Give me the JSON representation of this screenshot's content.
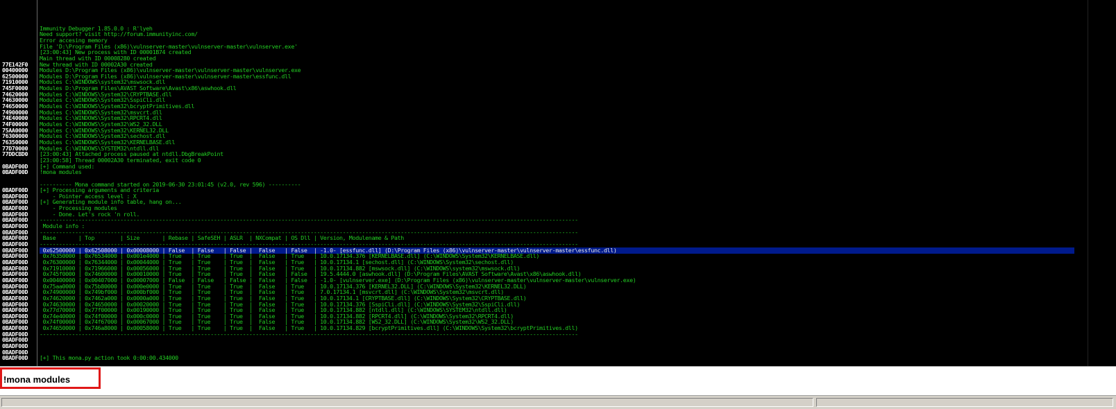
{
  "log": {
    "lines": [
      {
        "addr": "",
        "text": ""
      },
      {
        "addr": "",
        "text": ""
      },
      {
        "addr": "",
        "text": ""
      },
      {
        "addr": "",
        "text": ""
      },
      {
        "addr": "",
        "text": "Immunity Debugger 1.85.0.0 : R'lyeh"
      },
      {
        "addr": "",
        "text": "Need support? visit http://forum.immunityinc.com/"
      },
      {
        "addr": "",
        "text": "Error accesing memory"
      },
      {
        "addr": "",
        "text": "File 'D:\\Program Files (x86)\\vulnserver-master\\vulnserver-master\\vulnserver.exe'"
      },
      {
        "addr": "",
        "text": "[23:00:43] New process with ID 00001B74 created"
      },
      {
        "addr": "",
        "text": "Main thread with ID 00008280 created"
      },
      {
        "addr": "77E142F0",
        "text": "New thread with ID 00002A30 created"
      },
      {
        "addr": "00400000",
        "text": "Modules D:\\Program Files (x86)\\vulnserver-master\\vulnserver-master\\vulnserver.exe"
      },
      {
        "addr": "62500000",
        "text": "Modules D:\\Program Files (x86)\\vulnserver-master\\vulnserver-master\\essfunc.dll"
      },
      {
        "addr": "71910000",
        "text": "Modules C:\\WINDOWS\\system32\\mswsock.dll"
      },
      {
        "addr": "745F0000",
        "text": "Modules D:\\Program Files\\AVAST Software\\Avast\\x86\\aswhook.dll"
      },
      {
        "addr": "74620000",
        "text": "Modules C:\\WINDOWS\\System32\\CRYPTBASE.dll"
      },
      {
        "addr": "74630000",
        "text": "Modules C:\\WINDOWS\\System32\\SspiCli.dll"
      },
      {
        "addr": "74650000",
        "text": "Modules C:\\WINDOWS\\System32\\bcryptPrimitives.dll"
      },
      {
        "addr": "74900000",
        "text": "Modules C:\\WINDOWS\\System32\\msvcrt.dll"
      },
      {
        "addr": "74E40000",
        "text": "Modules C:\\WINDOWS\\System32\\RPCRT4.dll"
      },
      {
        "addr": "74F00000",
        "text": "Modules C:\\WINDOWS\\System32\\WS2_32.DLL"
      },
      {
        "addr": "75AA0000",
        "text": "Modules C:\\WINDOWS\\System32\\KERNEL32.DLL"
      },
      {
        "addr": "76300000",
        "text": "Modules C:\\WINDOWS\\System32\\sechost.dll"
      },
      {
        "addr": "76350000",
        "text": "Modules C:\\WINDOWS\\System32\\KERNELBASE.dll"
      },
      {
        "addr": "77D70000",
        "text": "Modules C:\\WINDOWS\\SYSTEM32\\ntdll.dll"
      },
      {
        "addr": "77DDCBD0",
        "text": "[23:00:43] Attached process paused at ntdll.DbgBreakPoint"
      },
      {
        "addr": "",
        "text": "[23:00:58] Thread 00002A30 terminated, exit code 0"
      },
      {
        "addr": "0BADF00D",
        "text": "[+] Command used:"
      },
      {
        "addr": "0BADF00D",
        "text": "!mona modules"
      },
      {
        "addr": "",
        "text": ""
      },
      {
        "addr": "",
        "text": "---------- Mona command started on 2019-06-30 23:01:45 (v2.0, rev 596) ----------"
      },
      {
        "addr": "0BADF00D",
        "text": "[+] Processing arguments and criteria"
      },
      {
        "addr": "0BADF00D",
        "text": "    - Pointer access level : X"
      },
      {
        "addr": "0BADF00D",
        "text": "[+] Generating module info table, hang on..."
      },
      {
        "addr": "0BADF00D",
        "text": "    - Processing modules"
      },
      {
        "addr": "0BADF00D",
        "text": "    - Done. Let's rock 'n roll."
      },
      {
        "addr": "0BADF00D",
        "text": "-----------------------------------------------------------------------------------------------------------------------------------------------------------------------"
      },
      {
        "addr": "0BADF00D",
        "text": " Module info :"
      },
      {
        "addr": "0BADF00D",
        "text": "-----------------------------------------------------------------------------------------------------------------------------------------------------------------------"
      },
      {
        "addr": "0BADF00D",
        "text": " Base       | Top        | Size       | Rebase | SafeSEH | ASLR  | NXCompat | OS Dll | Version, Modulename & Path"
      },
      {
        "addr": "0BADF00D",
        "text": "-----------------------------------------------------------------------------------------------------------------------------------------------------------------------"
      },
      {
        "addr": "0BADF00D",
        "text": " 0x62500000 | 0x62508000 | 0x00008000 | False  | False   | False |  False   | False  | -1.0- [essfunc.dll] (D:\\Program Files (x86)\\vulnserver-master\\vulnserver-master\\essfunc.dll)",
        "selected": true
      },
      {
        "addr": "0BADF00D",
        "text": " 0x76350000 | 0x76534000 | 0x001e4000 | True   | True    | True  |  False   | True   | 10.0.17134.376 [KERNELBASE.dll] (C:\\WINDOWS\\System32\\KERNELBASE.dll)"
      },
      {
        "addr": "0BADF00D",
        "text": " 0x76300000 | 0x76344000 | 0x00044000 | True   | True    | True  |  False   | True   | 10.0.17134.1 [sechost.dll] (C:\\WINDOWS\\System32\\sechost.dll)"
      },
      {
        "addr": "0BADF00D",
        "text": " 0x71910000 | 0x71966000 | 0x00056000 | True   | True    | True  |  False   | True   | 10.0.17134.882 [mswsock.dll] (C:\\WINDOWS\\system32\\mswsock.dll)"
      },
      {
        "addr": "0BADF00D",
        "text": " 0x745f0000 | 0x74600000 | 0x00010000 | True   | True    | True  |  False   | False  | 19.5.4444.0 [aswhook.dll] (D:\\Program Files\\AVAST Software\\Avast\\x86\\aswhook.dll)"
      },
      {
        "addr": "0BADF00D",
        "text": " 0x00400000 | 0x00407000 | 0x00007000 | False  | False   | False |  False   | False  | -1.0- [vulnserver.exe] (D:\\Program Files (x86)\\vulnserver-master\\vulnserver-master\\vulnserver.exe)"
      },
      {
        "addr": "0BADF00D",
        "text": " 0x75aa0000 | 0x75b80000 | 0x000e0000 | True   | True    | True  |  False   | True   | 10.0.17134.376 [KERNEL32.DLL] (C:\\WINDOWS\\System32\\KERNEL32.DLL)"
      },
      {
        "addr": "0BADF00D",
        "text": " 0x74900000 | 0x749bf000 | 0x000bf000 | True   | True    | True  |  False   | True   | 7.0.17134.1 [msvcrt.dll] (C:\\WINDOWS\\System32\\msvcrt.dll)"
      },
      {
        "addr": "0BADF00D",
        "text": " 0x74620000 | 0x7462a000 | 0x0000a000 | True   | True    | True  |  False   | True   | 10.0.17134.1 [CRYPTBASE.dll] (C:\\WINDOWS\\System32\\CRYPTBASE.dll)"
      },
      {
        "addr": "0BADF00D",
        "text": " 0x74630000 | 0x74650000 | 0x00020000 | True   | True    | True  |  False   | True   | 10.0.17134.376 [SspiCli.dll] (C:\\WINDOWS\\System32\\SspiCli.dll)"
      },
      {
        "addr": "0BADF00D",
        "text": " 0x77d70000 | 0x77f00000 | 0x00190000 | True   | True    | True  |  False   | True   | 10.0.17134.882 [ntdll.dll] (C:\\WINDOWS\\SYSTEM32\\ntdll.dll)"
      },
      {
        "addr": "0BADF00D",
        "text": " 0x74e40000 | 0x74f00000 | 0x000c0000 | True   | True    | True  |  False   | True   | 10.0.17134.882 [RPCRT4.dll] (C:\\WINDOWS\\System32\\RPCRT4.dll)"
      },
      {
        "addr": "0BADF00D",
        "text": " 0x74f00000 | 0x74f67000 | 0x00067000 | True   | True    | True  |  False   | True   | 10.0.17134.882 [WS2_32.DLL] (C:\\WINDOWS\\System32\\WS2_32.DLL)"
      },
      {
        "addr": "0BADF00D",
        "text": " 0x74650000 | 0x746a8000 | 0x00058000 | True   | True    | True  |  False   | True   | 10.0.17134.829 [bcryptPrimitives.dll] (C:\\WINDOWS\\System32\\bcryptPrimitives.dll)"
      },
      {
        "addr": "0BADF00D",
        "text": "-----------------------------------------------------------------------------------------------------------------------------------------------------------------------"
      },
      {
        "addr": "0BADF00D",
        "text": ""
      },
      {
        "addr": "0BADF00D",
        "text": ""
      },
      {
        "addr": "0BADF00D",
        "text": ""
      },
      {
        "addr": "0BADF00D",
        "text": "[+] This mona.py action took 0:00:00.434000"
      }
    ]
  },
  "command_bar": {
    "value": "!mona modules"
  },
  "colors": {
    "log_text": "#22cc22",
    "address_text": "#ffffff",
    "selection": "#001a8c",
    "highlight_box": "#e01818"
  }
}
